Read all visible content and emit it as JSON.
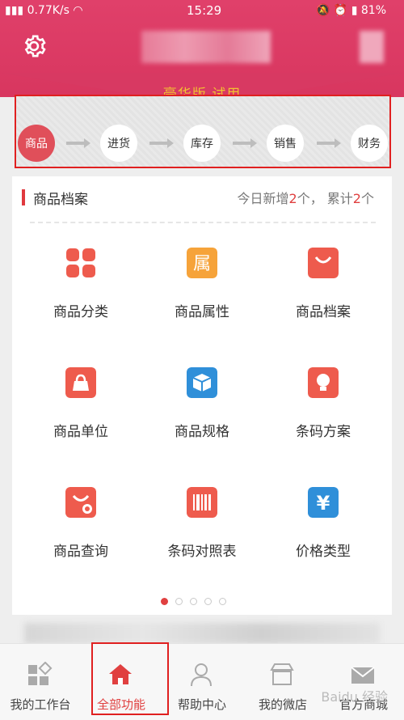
{
  "status_bar": {
    "network": "0.77K/s",
    "time": "15:29",
    "battery": "81%"
  },
  "header": {
    "edition": "豪华版 试用"
  },
  "flow": {
    "steps": [
      "商品",
      "进货",
      "库存",
      "销售",
      "财务"
    ]
  },
  "card": {
    "title": "商品档案",
    "stats_prefix": "今日新增",
    "today_count": "2",
    "stats_mid": "个， 累计",
    "total_count": "2",
    "stats_suffix": "个",
    "items": [
      {
        "label": "商品分类",
        "icon": "grid-icon",
        "color": "#ee5b4d"
      },
      {
        "label": "商品属性",
        "icon": "attribute-icon",
        "color": "#f6a33a",
        "glyph": "属"
      },
      {
        "label": "商品档案",
        "icon": "shopping-bag-icon",
        "color": "#ee5b4d"
      },
      {
        "label": "商品单位",
        "icon": "handbag-icon",
        "color": "#ee5b4d"
      },
      {
        "label": "商品规格",
        "icon": "box-icon",
        "color": "#2f8fd9"
      },
      {
        "label": "条码方案",
        "icon": "lightbulb-icon",
        "color": "#ee5b4d"
      },
      {
        "label": "商品查询",
        "icon": "bag-search-icon",
        "color": "#ee5b4d"
      },
      {
        "label": "条码对照表",
        "icon": "barcode-icon",
        "color": "#ee5b4d"
      },
      {
        "label": "价格类型",
        "icon": "yen-icon",
        "color": "#2f8fd9",
        "glyph": "¥"
      }
    ]
  },
  "tabs": [
    {
      "label": "我的工作台",
      "icon": "workbench-icon"
    },
    {
      "label": "全部功能",
      "icon": "home-icon",
      "active": true
    },
    {
      "label": "帮助中心",
      "icon": "help-person-icon"
    },
    {
      "label": "我的微店",
      "icon": "store-icon"
    },
    {
      "label": "官方商城",
      "icon": "mail-icon"
    }
  ],
  "watermark": "Baidu 经验"
}
